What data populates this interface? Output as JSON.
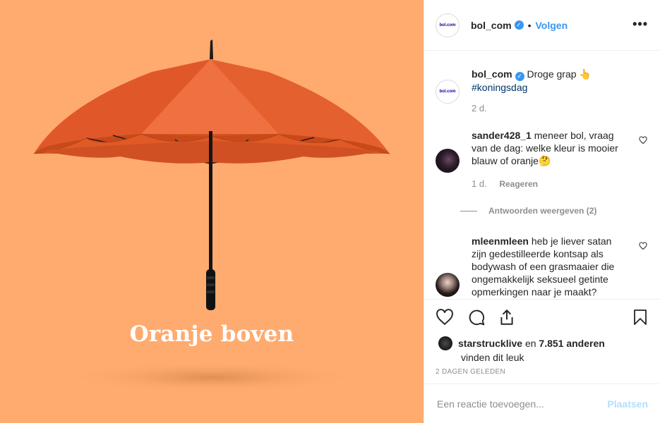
{
  "media": {
    "caption_art": "Oranje boven",
    "colors": {
      "background": "#ffab6f",
      "canopy": "#e8622b"
    }
  },
  "header": {
    "avatar_text": "bol.com",
    "username": "bol_com",
    "separator": "•",
    "follow_label": "Volgen",
    "more_label": "•••"
  },
  "caption": {
    "username": "bol_com",
    "text": "Droge grap 👆",
    "hashtag": "#koningsdag",
    "time": "2 d."
  },
  "comments": [
    {
      "username": "sander428_1",
      "text": "meneer bol, vraag van de dag: welke kleur is mooier blauw of oranje🤔",
      "time": "1 d.",
      "reply_label": "Reageren",
      "view_replies_label": "Antwoorden weergeven (2)"
    },
    {
      "username": "mleenmleen",
      "text": "heb je liever satan zijn gedestilleerde kontsap als bodywash of een grasmaaier die ongemakkelijk seksueel getinte opmerkingen naar je maakt?"
    }
  ],
  "likes": {
    "liker": "starstrucklive",
    "and_label": "en",
    "others": "7.851 anderen",
    "line2": "vinden dit leuk"
  },
  "timestamp": "2 DAGEN GELEDEN",
  "add_comment": {
    "placeholder": "Een reactie toevoegen...",
    "post_label": "Plaatsen"
  },
  "icons": [
    "heart-icon",
    "comment-icon",
    "share-icon",
    "bookmark-icon",
    "verified-icon",
    "more-icon"
  ]
}
